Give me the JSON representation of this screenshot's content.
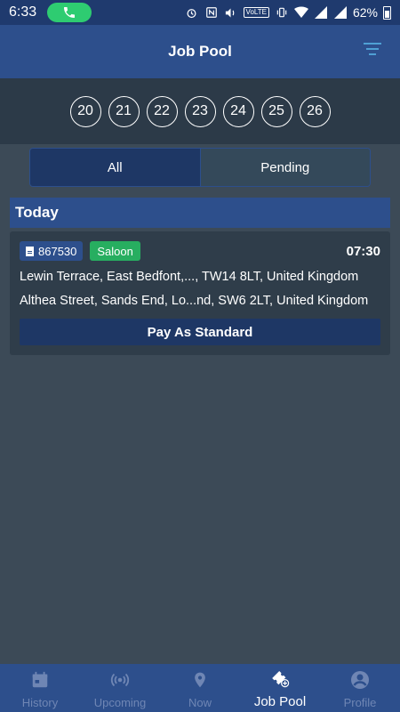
{
  "status_bar": {
    "time": "6:33",
    "volte": "VoLTE",
    "battery": "62%"
  },
  "app_bar": {
    "title": "Job Pool"
  },
  "dates": [
    "20",
    "21",
    "22",
    "23",
    "24",
    "25",
    "26"
  ],
  "segments": {
    "all": "All",
    "pending": "Pending",
    "selected": "All"
  },
  "section_header": "Today",
  "job": {
    "id": "867530",
    "vehicle": "Saloon",
    "time": "07:30",
    "pickup": "Lewin Terrace, East Bedfont,..., TW14 8LT, United Kingdom",
    "dropoff": "Althea Street, Sands End, Lo...nd, SW6 2LT, United Kingdom",
    "payment": "Pay As Standard"
  },
  "bottom_nav": [
    {
      "label": "History",
      "icon": "calendar-icon"
    },
    {
      "label": "Upcoming",
      "icon": "radar-icon"
    },
    {
      "label": "Now",
      "icon": "location-pin-icon"
    },
    {
      "label": "Job Pool",
      "icon": "ticket-add-icon",
      "active": true
    },
    {
      "label": "Profile",
      "icon": "account-icon"
    }
  ],
  "colors": {
    "primary": "#2d4f8c",
    "background": "#3c4a57",
    "accent_green": "#27ae60",
    "inactive_nav": "#6f86b4"
  }
}
